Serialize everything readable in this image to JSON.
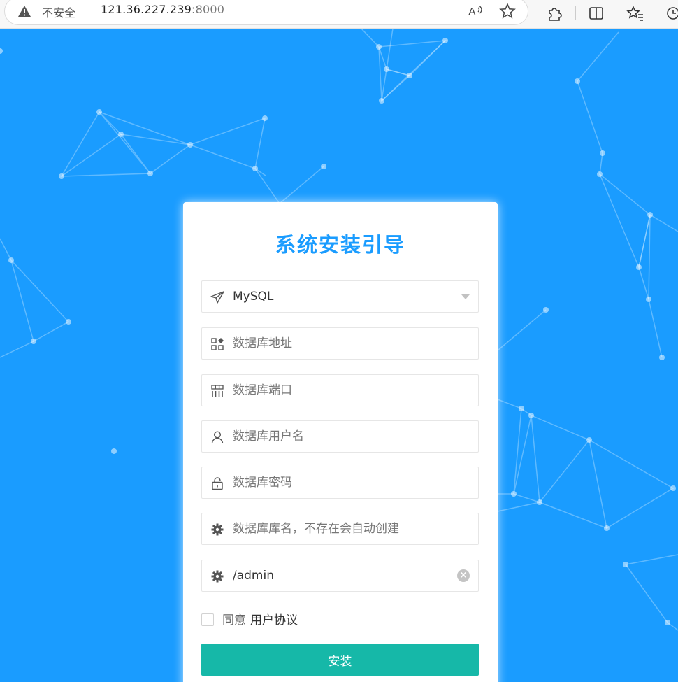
{
  "browser": {
    "security_label": "不安全",
    "url_host": "121.36.227.239",
    "url_port": ":8000"
  },
  "form": {
    "title": "系统安装引导",
    "db_type": {
      "value": "MySQL",
      "icon": "paper-plane-icon"
    },
    "db_host": {
      "placeholder": "数据库地址",
      "icon": "apps-icon"
    },
    "db_port": {
      "placeholder": "数据库端口",
      "icon": "grid-icon"
    },
    "db_user": {
      "placeholder": "数据库用户名",
      "icon": "user-icon"
    },
    "db_password": {
      "placeholder": "数据库密码",
      "icon": "lock-icon"
    },
    "db_name": {
      "placeholder": "数据库库名，不存在会自动创建",
      "icon": "gear-icon"
    },
    "admin_path": {
      "value": "/admin",
      "icon": "gear-icon"
    },
    "agree_label": "同意",
    "agree_link": "用户协议",
    "submit_label": "安装"
  },
  "colors": {
    "background": "#1a9cff",
    "title": "#1a9cff",
    "button": "#16b8a8"
  }
}
